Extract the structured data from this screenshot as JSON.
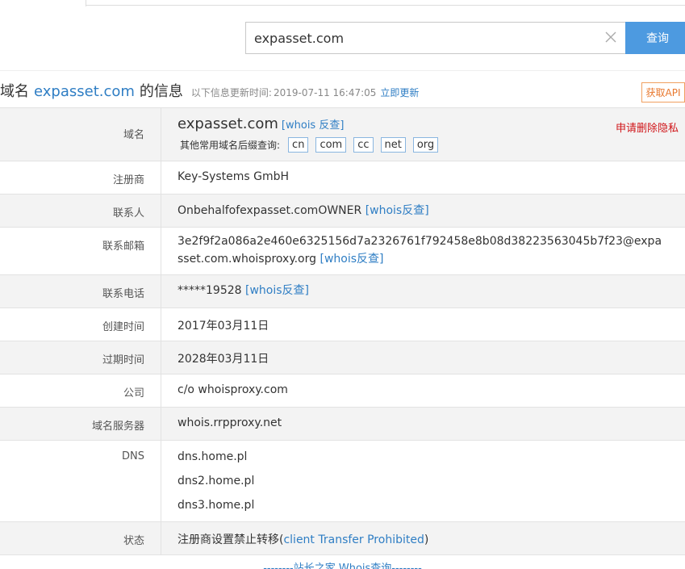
{
  "search": {
    "value": "expasset.com",
    "button_label": "查询"
  },
  "header": {
    "prefix": "域名",
    "domain": "expasset.com",
    "suffix": "的信息",
    "update_label": "以下信息更新时间:",
    "update_time": "2019-07-11 16:47:05",
    "update_link": "立即更新",
    "api_label": "获取API"
  },
  "table": {
    "domain_row": {
      "label": "域名",
      "domain": "expasset.com",
      "whois_reverse": "[whois 反查]",
      "privacy_link": "申请删除隐私",
      "suffix_label": "其他常用域名后缀查询:",
      "suffixes": [
        "cn",
        "com",
        "cc",
        "net",
        "org"
      ]
    },
    "registrar": {
      "label": "注册商",
      "value": "Key-Systems GmbH"
    },
    "contact": {
      "label": "联系人",
      "value": "Onbehalfofexpasset.comOWNER",
      "link": "[whois反查]"
    },
    "email": {
      "label": "联系邮箱",
      "value": "3e2f9f2a086a2e460e6325156d7a2326761f792458e8b08d38223563045b7f23@expasset.com.whoisproxy.org",
      "link": "[whois反查]"
    },
    "phone": {
      "label": "联系电话",
      "value": "*****19528",
      "link": "[whois反查]"
    },
    "created": {
      "label": "创建时间",
      "value": "2017年03月11日"
    },
    "expires": {
      "label": "过期时间",
      "value": "2028年03月11日"
    },
    "company": {
      "label": "公司",
      "value": "c/o whoisproxy.com"
    },
    "nameserver": {
      "label": "域名服务器",
      "value": "whois.rrpproxy.net"
    },
    "dns": {
      "label": "DNS",
      "values": [
        "dns.home.pl",
        "dns2.home.pl",
        "dns3.home.pl"
      ]
    },
    "status": {
      "label": "状态",
      "prefix": "注册商设置禁止转移(",
      "link": "client Transfer Prohibited",
      "suffix": ")"
    }
  },
  "footer": {
    "text": "--------站长之家 Whois查询--------"
  }
}
